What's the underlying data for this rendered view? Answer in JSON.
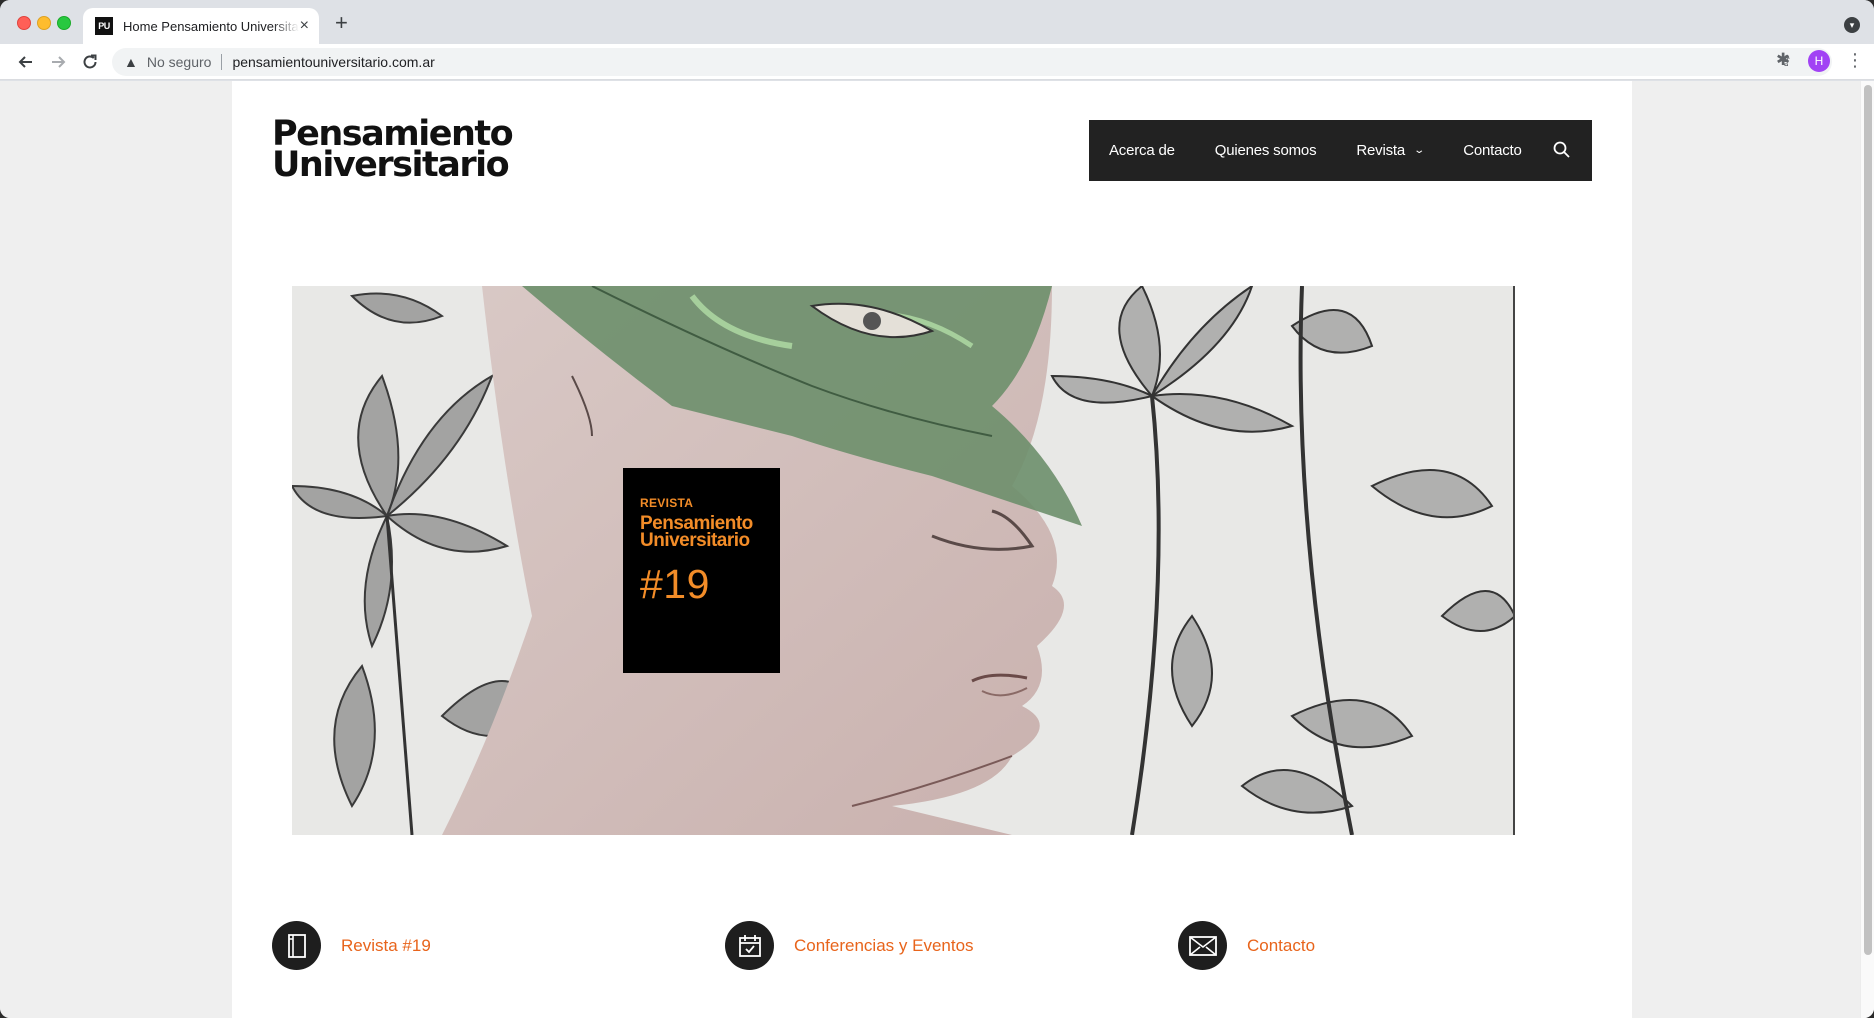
{
  "browser": {
    "tab_favicon": "PU",
    "tab_title": "Home Pensamiento Universitario",
    "tab_close": "×",
    "new_tab": "+",
    "security_label": "No seguro",
    "url": "pensamientouniversitario.com.ar",
    "profile_initial": "H"
  },
  "site": {
    "logo_line1": "Pensamiento",
    "logo_line2": "Universitario",
    "nav": [
      {
        "label": "Acerca de"
      },
      {
        "label": "Quienes somos"
      },
      {
        "label": "Revista",
        "has_dropdown": true
      },
      {
        "label": "Contacto"
      }
    ]
  },
  "hero": {
    "badge_kicker": "REVISTA",
    "badge_title_line1": "Pensamiento",
    "badge_title_line2": "Universitario",
    "badge_number": "#19",
    "badge_color": "#f28c28"
  },
  "features": [
    {
      "label": "Revista #19",
      "icon": "book-icon"
    },
    {
      "label": "Conferencias y Eventos",
      "icon": "calendar-check-icon"
    },
    {
      "label": "Contacto",
      "icon": "envelope-icon"
    }
  ],
  "colors": {
    "nav_bg": "#222222",
    "feature_link": "#e8641b",
    "icon_circle": "#1e1e1e"
  }
}
